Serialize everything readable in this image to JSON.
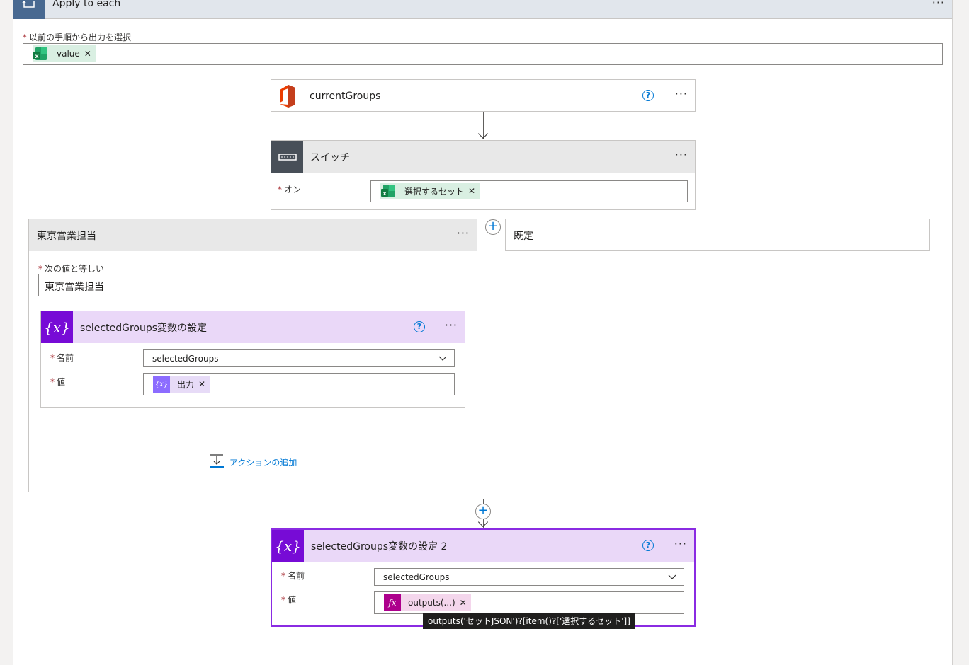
{
  "loop": {
    "title": "Apply to each",
    "more": "···"
  },
  "select_output": {
    "label": "以前の手順から出力を選択",
    "required": "*",
    "token": "value"
  },
  "current_groups": {
    "title": "currentGroups",
    "help": "?",
    "more": "···"
  },
  "switch": {
    "title": "スイッチ",
    "more": "···",
    "on_label": "オン",
    "on_token": "選択するセット"
  },
  "case": {
    "title": "東京営業担当",
    "more": "···",
    "equals_label": "次の値と等しい",
    "equals_value": "東京営業担当",
    "add_action": "アクションの追加"
  },
  "default_case": {
    "title": "既定"
  },
  "set_var_1": {
    "title": "selectedGroups変数の設定",
    "help": "?",
    "more": "···",
    "name_label": "名前",
    "name_value": "selectedGroups",
    "value_label": "値",
    "value_token": "出力"
  },
  "set_var_2": {
    "title": "selectedGroups変数の設定 2",
    "help": "?",
    "more": "···",
    "name_label": "名前",
    "name_value": "selectedGroups",
    "value_label": "値",
    "value_token": "outputs(...)"
  },
  "tooltip": "outputs('セットJSON')?[item()?['選択するセット']]",
  "colors": {
    "accent": "#0078d4",
    "variable": "#770bd6",
    "loop": "#486991",
    "switch": "#484f58",
    "office": "#eb3c00"
  }
}
